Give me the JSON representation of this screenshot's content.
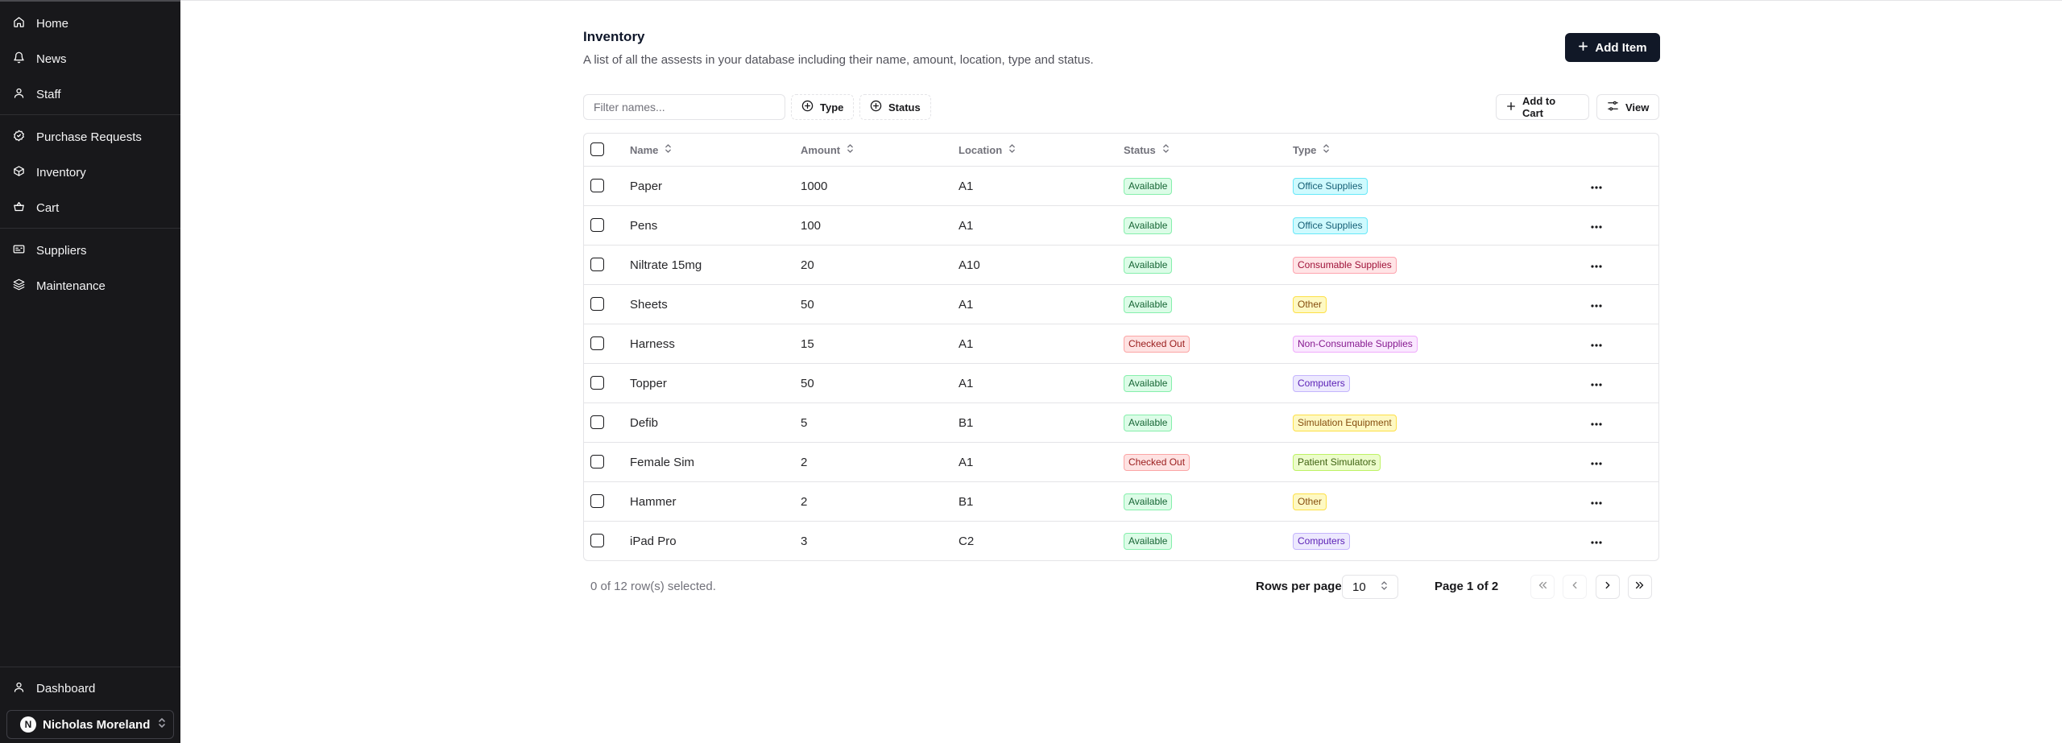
{
  "sidebar": {
    "nav": [
      {
        "label": "Home",
        "icon": "home-icon"
      },
      {
        "label": "News",
        "icon": "bell-icon"
      },
      {
        "label": "Staff",
        "icon": "user-icon"
      },
      {
        "label": "Purchase Requests",
        "icon": "badge-icon"
      },
      {
        "label": "Inventory",
        "icon": "package-icon"
      },
      {
        "label": "Cart",
        "icon": "basket-icon"
      },
      {
        "label": "Suppliers",
        "icon": "id-card-icon"
      },
      {
        "label": "Maintenance",
        "icon": "layers-icon"
      }
    ],
    "dashboard_label": "Dashboard",
    "user": {
      "initial": "N",
      "name": "Nicholas Moreland"
    }
  },
  "header": {
    "title": "Inventory",
    "description": "A list of all the assests in your database including their name, amount, location, type and status.",
    "add_item_label": "Add Item"
  },
  "toolbar": {
    "filter_placeholder": "Filter names...",
    "filter_value": "",
    "type_label": "Type",
    "status_label": "Status",
    "add_to_cart_label": "Add to Cart",
    "view_label": "View"
  },
  "table": {
    "columns": [
      "Name",
      "Amount",
      "Location",
      "Status",
      "Type"
    ],
    "rows": [
      {
        "name": "Paper",
        "amount": "1000",
        "location": "A1",
        "status": "Available",
        "type": "Office Supplies"
      },
      {
        "name": "Pens",
        "amount": "100",
        "location": "A1",
        "status": "Available",
        "type": "Office Supplies"
      },
      {
        "name": "Niltrate 15mg",
        "amount": "20",
        "location": "A10",
        "status": "Available",
        "type": "Consumable Supplies"
      },
      {
        "name": "Sheets",
        "amount": "50",
        "location": "A1",
        "status": "Available",
        "type": "Other"
      },
      {
        "name": "Harness",
        "amount": "15",
        "location": "A1",
        "status": "Checked Out",
        "type": "Non-Consumable Supplies"
      },
      {
        "name": "Topper",
        "amount": "50",
        "location": "A1",
        "status": "Available",
        "type": "Computers"
      },
      {
        "name": "Defib",
        "amount": "5",
        "location": "B1",
        "status": "Available",
        "type": "Simulation Equipment"
      },
      {
        "name": "Female Sim",
        "amount": "2",
        "location": "A1",
        "status": "Checked Out",
        "type": "Patient Simulators"
      },
      {
        "name": "Hammer",
        "amount": "2",
        "location": "B1",
        "status": "Available",
        "type": "Other"
      },
      {
        "name": "iPad Pro",
        "amount": "3",
        "location": "C2",
        "status": "Available",
        "type": "Computers"
      }
    ]
  },
  "footer": {
    "selection_text": "0 of 12 row(s) selected.",
    "rows_per_page_label": "Rows per page",
    "rows_per_page_value": "10",
    "page_info": "Page 1 of 2"
  },
  "colors": {
    "sidebar_bg": "#18181b",
    "primary_button": "#111827",
    "available": "#166534",
    "checked_out": "#991b1b"
  }
}
